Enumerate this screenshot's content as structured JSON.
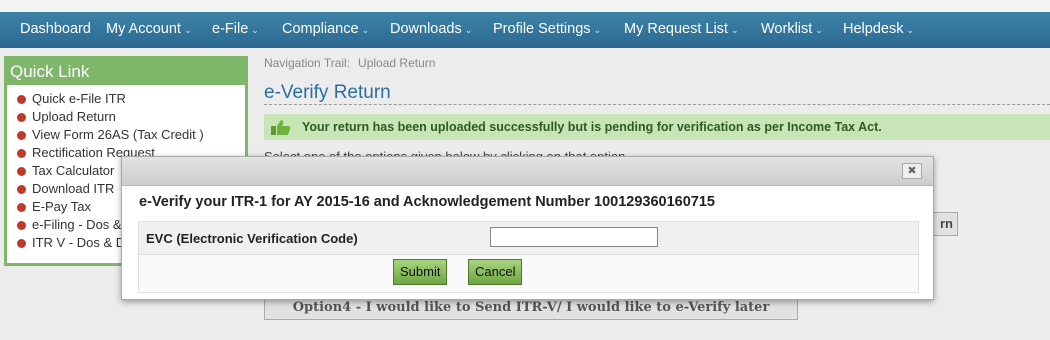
{
  "nav": {
    "items": [
      {
        "label": "Dashboard",
        "caret": false
      },
      {
        "label": "My Account",
        "caret": true
      },
      {
        "label": "e-File",
        "caret": true
      },
      {
        "label": "Compliance",
        "caret": true
      },
      {
        "label": "Downloads",
        "caret": true
      },
      {
        "label": "Profile Settings",
        "caret": true
      },
      {
        "label": "My Request List",
        "caret": true
      },
      {
        "label": "Worklist",
        "caret": true
      },
      {
        "label": "Helpdesk",
        "caret": true
      }
    ],
    "caret_glyph": "⌄"
  },
  "quick_link": {
    "title": "Quick Link",
    "items": [
      "Quick e-File ITR",
      "Upload Return",
      "View Form 26AS (Tax Credit )",
      "Rectification Request",
      "Tax Calculator",
      "Download ITR",
      "E-Pay Tax",
      "e-Filing - Dos & Don'ts",
      "ITR V - Dos & Don'ts"
    ]
  },
  "breadcrumb": {
    "label": "Navigation Trail:",
    "current": "Upload Return"
  },
  "page": {
    "title": "e-Verify Return",
    "success_message": "Your return has been uploaded successfully but is pending for verification as per Income Tax Act.",
    "select_instruction": "Select one of the options given below by clicking on that option.",
    "option_fragment": "rn",
    "option4": "Option4 - I would like to Send ITR-V/ I would like to e-Verify later"
  },
  "modal": {
    "close_glyph": "✖",
    "title": "e-Verify your ITR-1 for AY 2015-16 and Acknowledgement Number 100129360160715",
    "evc_label": "EVC (Electronic Verification Code)",
    "evc_value": "",
    "submit_label": "Submit",
    "cancel_label": "Cancel"
  },
  "colors": {
    "nav_bg": "#3377a0",
    "quick_link_bg": "#7eb66a",
    "bullet": "#c0392b",
    "success_bg": "#c7e5b6",
    "button_green": "#8cc05c",
    "page_title": "#2c6f9e"
  },
  "icons": {
    "success": "thumbs-up-icon",
    "close": "close-icon",
    "bullet": "bullet-icon"
  }
}
